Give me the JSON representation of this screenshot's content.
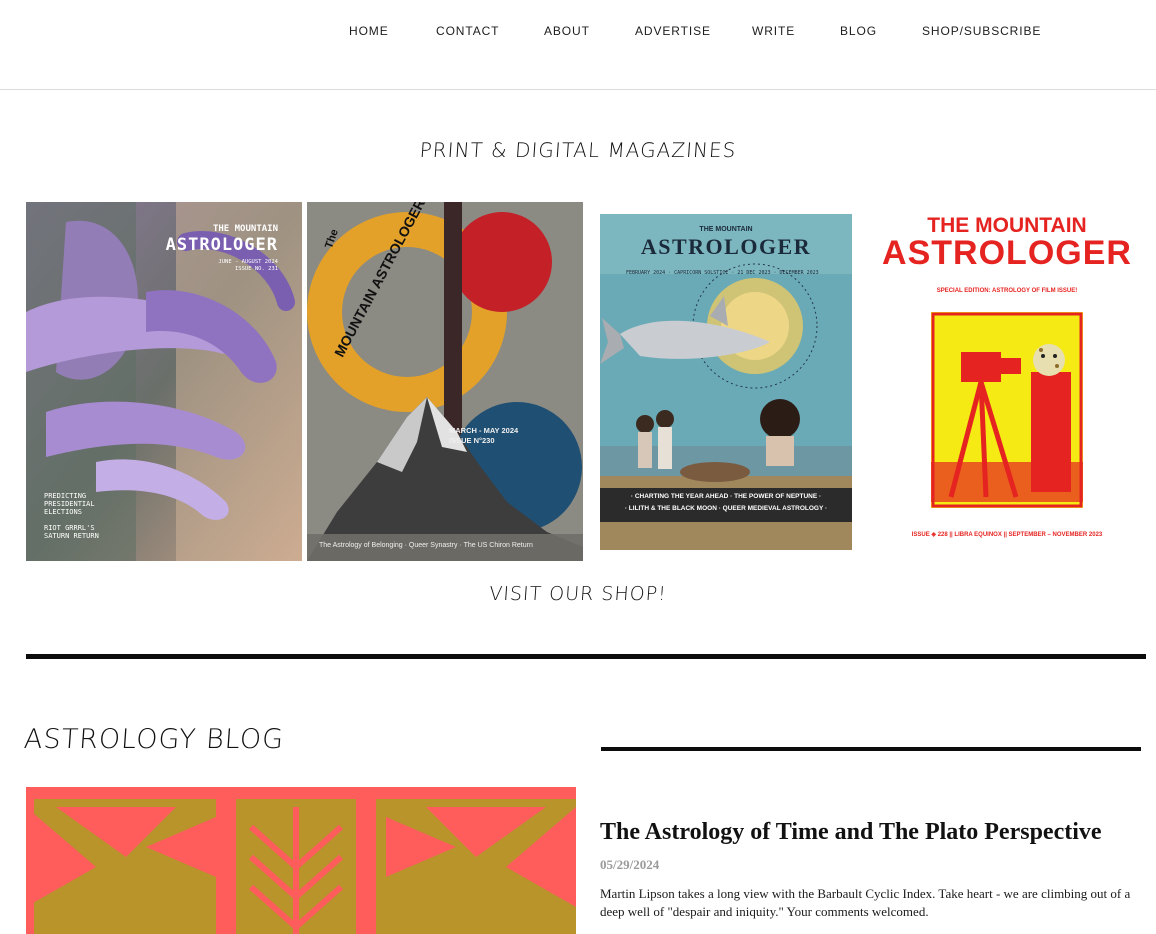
{
  "nav": {
    "items": [
      {
        "label": "HOME"
      },
      {
        "label": "CONTACT"
      },
      {
        "label": "ABOUT"
      },
      {
        "label": "ADVERTISE"
      },
      {
        "label": "WRITE"
      },
      {
        "label": "BLOG"
      },
      {
        "label": "SHOP/SUBSCRIBE"
      }
    ]
  },
  "magazines": {
    "heading": "PRINT & DIGITAL MAGAZINES",
    "covers": [
      {
        "masthead_top": "THE MOUNTAIN",
        "masthead": "ASTROLOGER",
        "issue_line1": "JUNE - AUGUST 2024",
        "issue_line2": "ISSUE NO. 231",
        "feature1": "PREDICTING\nPRESIDENTIAL\nELECTIONS",
        "feature2": "RIOT GRRRL'S\nSATURN RETURN"
      },
      {
        "masthead_the": "The",
        "masthead": "MOUNTAIN ASTROLOGER",
        "issue_line1": "MARCH - MAY 2024",
        "issue_line2": "ISSUE N°230",
        "footer": "The Astrology of Belonging · Queer Synastry · The US Chiron Return"
      },
      {
        "masthead_top": "THE MOUNTAIN",
        "masthead": "ASTROLOGER",
        "ring_text": "FEBRUARY 2024 · CAPRICORN SOLSTICE · 21 DEC 2023 · DECEMBER 2023 ·",
        "features1": "· CHARTING THE YEAR AHEAD · THE POWER OF NEPTUNE ·",
        "features2": "· LILITH & THE BLACK MOON · QUEER MEDIEVAL ASTROLOGY ·"
      },
      {
        "masthead_top": "THE MOUNTAIN",
        "masthead": "ASTROLOGER",
        "edition": "SPECIAL EDITION: ASTROLOGY OF FILM ISSUE!",
        "footer": "ISSUE ◈ 228 || LIBRA EQUINOX || SEPTEMBER – NOVEMBER 2023"
      }
    ],
    "shop_link": "VISIT OUR SHOP!"
  },
  "blog": {
    "heading": "ASTROLOGY BLOG",
    "post": {
      "title": "The Astrology of Time and The Plato Perspective",
      "date": "05/29/2024",
      "excerpt": "Martin Lipson takes a long view with the Barbault Cyclic Index. Take heart - we are climbing out of a deep well of \"despair and iniquity.\" Your comments welcomed."
    }
  },
  "colors": {
    "text": "#111111",
    "nav_border": "#dcdcdc",
    "rule": "#0c0c0c",
    "date": "#9a9a9a",
    "cover4_red": "#e52421",
    "cover4_yellow": "#f5ea14",
    "blog_image_gold": "#b8942a",
    "blog_image_pink": "#ff5c5c"
  }
}
